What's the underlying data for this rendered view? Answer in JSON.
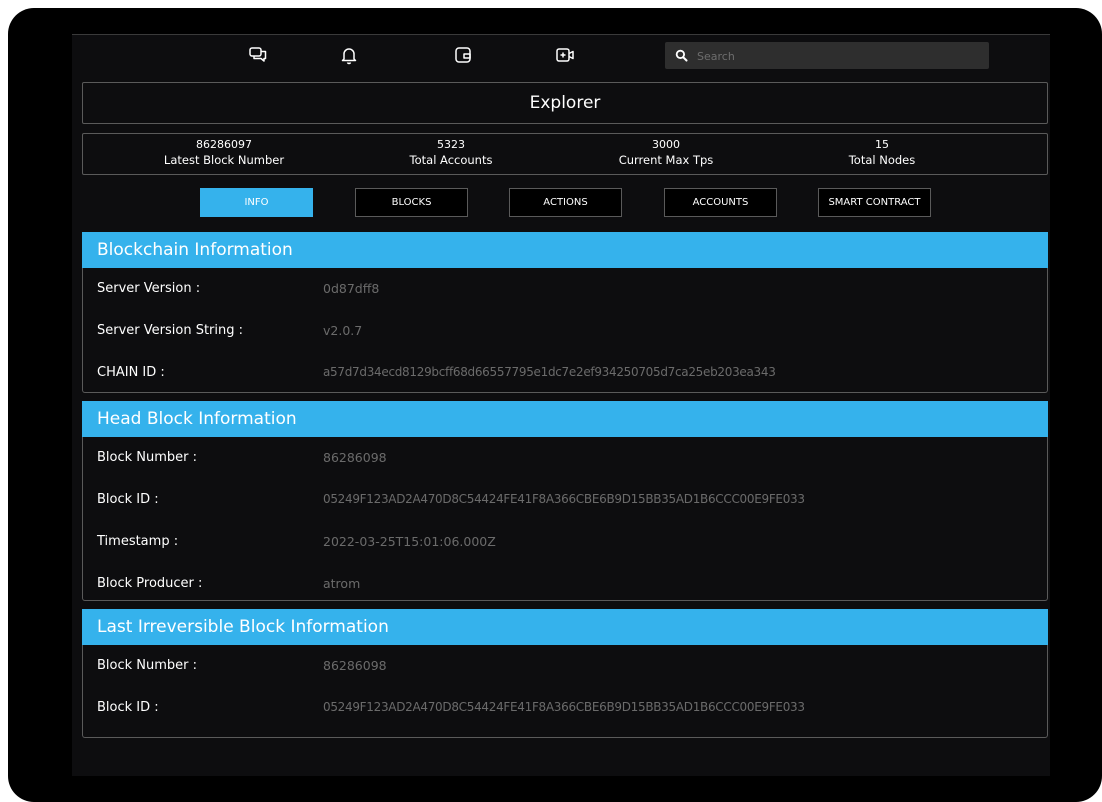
{
  "search": {
    "placeholder": "Search"
  },
  "header": {
    "title": "Explorer"
  },
  "stats": [
    {
      "value": "86286097",
      "label": "Latest Block Number"
    },
    {
      "value": "5323",
      "label": "Total Accounts"
    },
    {
      "value": "3000",
      "label": "Current Max Tps"
    },
    {
      "value": "15",
      "label": "Total Nodes"
    }
  ],
  "tabs": [
    {
      "label": "INFO",
      "active": true
    },
    {
      "label": "BLOCKS",
      "active": false
    },
    {
      "label": "ACTIONS",
      "active": false
    },
    {
      "label": "ACCOUNTS",
      "active": false
    },
    {
      "label": "SMART CONTRACT",
      "active": false
    }
  ],
  "blockchain_info": {
    "title": "Blockchain Information",
    "rows": [
      {
        "label": "Server Version :",
        "value": "0d87dff8"
      },
      {
        "label": "Server Version String :",
        "value": "v2.0.7"
      },
      {
        "label": "CHAIN ID :",
        "value": "a57d7d34ecd8129bcff68d66557795e1dc7e2ef934250705d7ca25eb203ea343"
      }
    ]
  },
  "head_block_info": {
    "title": "Head Block Information",
    "rows": [
      {
        "label": "Block Number :",
        "value": "86286098"
      },
      {
        "label": "Block ID :",
        "value": "05249F123AD2A470D8C54424FE41F8A366CBE6B9D15BB35AD1B6CCC00E9FE033"
      },
      {
        "label": "Timestamp :",
        "value": "2022-03-25T15:01:06.000Z"
      },
      {
        "label": "Block Producer :",
        "value": "atrom"
      }
    ]
  },
  "lib_info": {
    "title": "Last Irreversible Block Information",
    "rows": [
      {
        "label": "Block Number :",
        "value": "86286098"
      },
      {
        "label": "Block ID :",
        "value": "05249F123AD2A470D8C54424FE41F8A366CBE6B9D15BB35AD1B6CCC00E9FE033"
      }
    ]
  },
  "colors": {
    "accent": "#35b2ec",
    "background": "#0d0d0f",
    "muted_text": "#6b6b6b"
  },
  "icons": [
    "chat-icon",
    "bell-icon",
    "wallet-icon",
    "video-add-icon",
    "search-icon"
  ]
}
